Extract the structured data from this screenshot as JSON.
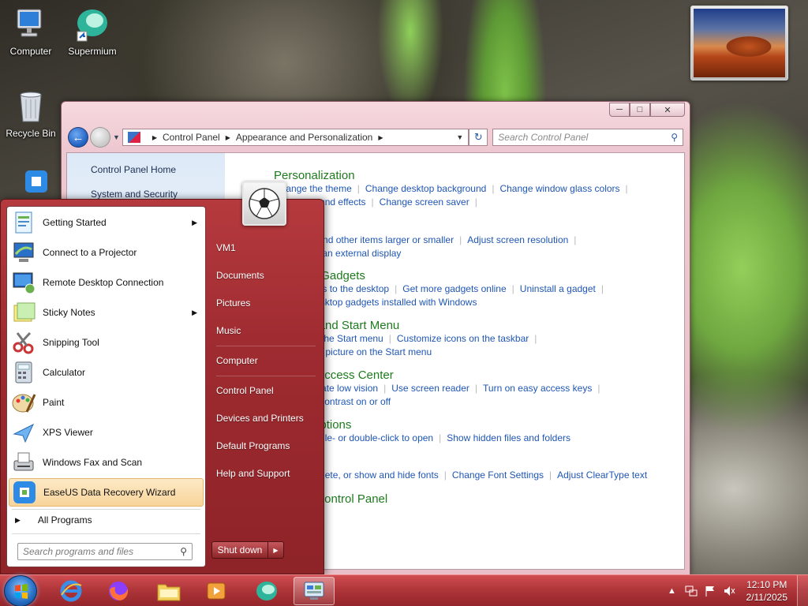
{
  "desktop": {
    "icons": [
      {
        "label": "Computer"
      },
      {
        "label": "Supermium"
      },
      {
        "label": "Recycle Bin"
      }
    ]
  },
  "control_panel": {
    "breadcrumb": [
      "Control Panel",
      "Appearance and Personalization"
    ],
    "search_placeholder": "Search Control Panel",
    "sidebar": [
      "Control Panel Home",
      "System and Security"
    ],
    "categories": [
      {
        "title": "Personalization",
        "links": [
          "Change the theme",
          "Change desktop background",
          "Change window glass colors"
        ],
        "links2": [
          "Change sound effects",
          "Change screen saver"
        ]
      },
      {
        "title": "",
        "links": [
          "Make text and other items larger or smaller",
          "Adjust screen resolution"
        ],
        "links2": [
          "Connect to an external display"
        ]
      },
      {
        "title": "Desktop Gadgets",
        "links": [
          "Add gadgets to the desktop",
          "Get more gadgets online",
          "Uninstall a gadget"
        ],
        "links2": [
          "Restore desktop gadgets installed with Windows"
        ]
      },
      {
        "title": "Taskbar and Start Menu",
        "links": [
          "Customize the Start menu",
          "Customize icons on the taskbar"
        ],
        "links2": [
          "Change the picture on the Start menu"
        ]
      },
      {
        "title": "Ease of Access Center",
        "links": [
          "Accommodate low vision",
          "Use screen reader",
          "Turn on easy access keys"
        ],
        "links2": [
          "Turn High Contrast on or off"
        ]
      },
      {
        "title": "Folder Options",
        "links": [
          "Specify single- or double-click to open",
          "Show hidden files and folders"
        ],
        "links2": []
      },
      {
        "title": "",
        "links": [
          "Preview, delete, or show and hide fonts",
          "Change Font Settings",
          "Adjust ClearType text"
        ],
        "links2": []
      },
      {
        "title": "NVIDIA Control Panel",
        "links": [],
        "links2": []
      }
    ]
  },
  "start_menu": {
    "programs": [
      {
        "label": "Getting Started",
        "has_submenu": true
      },
      {
        "label": "Connect to a Projector",
        "has_submenu": false
      },
      {
        "label": "Remote Desktop Connection",
        "has_submenu": false
      },
      {
        "label": "Sticky Notes",
        "has_submenu": true
      },
      {
        "label": "Snipping Tool",
        "has_submenu": false
      },
      {
        "label": "Calculator",
        "has_submenu": false
      },
      {
        "label": "Paint",
        "has_submenu": false
      },
      {
        "label": "XPS Viewer",
        "has_submenu": false
      },
      {
        "label": "Windows Fax and Scan",
        "has_submenu": false
      },
      {
        "label": "EaseUS Data Recovery Wizard",
        "has_submenu": false,
        "highlighted": true
      }
    ],
    "all_programs": "All Programs",
    "search_placeholder": "Search programs and files",
    "places": [
      "VM1",
      "Documents",
      "Pictures",
      "Music",
      "Computer",
      "Control Panel",
      "Devices and Printers",
      "Default Programs",
      "Help and Support"
    ],
    "shutdown": "Shut down"
  },
  "taskbar": {
    "clock_time": "12:10 PM",
    "clock_date": "2/11/2025"
  },
  "colors": {
    "taskbar": "#b0363a",
    "start_menu": "#9e2b30",
    "link": "#1f56b4",
    "category_title": "#1e7b1e",
    "highlight": "#f8d49a"
  }
}
